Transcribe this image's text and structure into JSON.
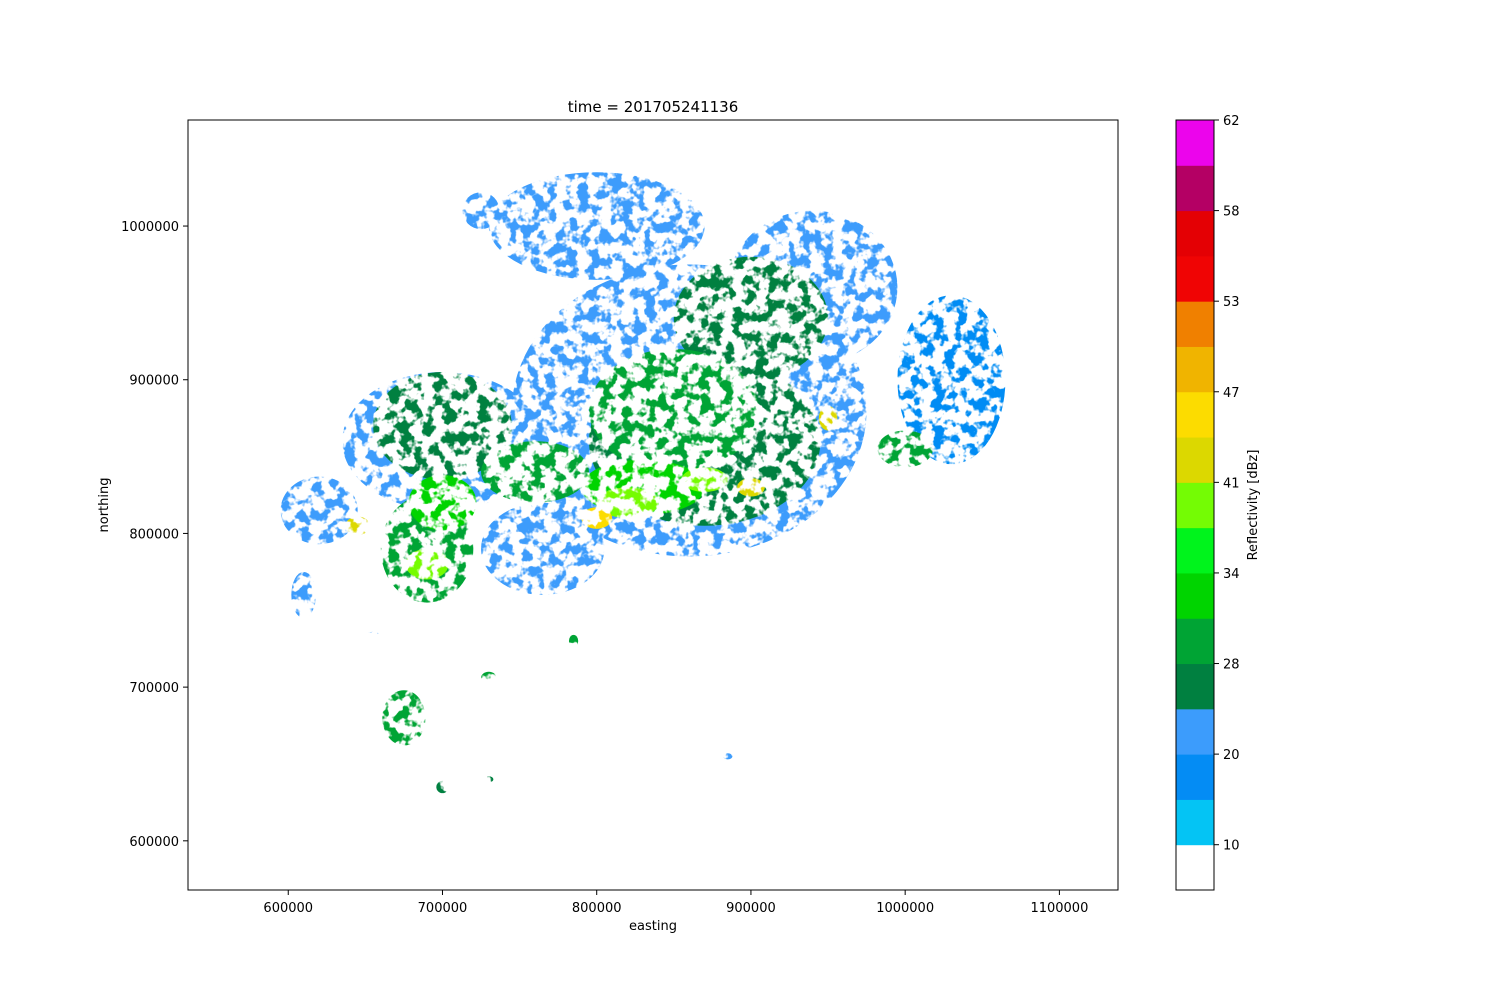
{
  "chart_data": {
    "type": "heatmap",
    "title": "time = 201705241136",
    "xlabel": "easting",
    "ylabel": "northing",
    "xlim": [
      535000,
      1138000
    ],
    "ylim": [
      568000,
      1069000
    ],
    "x_ticks": [
      600000,
      700000,
      800000,
      900000,
      1000000,
      1100000
    ],
    "y_ticks": [
      600000,
      700000,
      800000,
      900000,
      1000000
    ],
    "colorbar": {
      "label": "Reflectivity [dBz]",
      "tick_labels": [
        "10",
        "20",
        "28",
        "34",
        "41",
        "47",
        "53",
        "58",
        "62"
      ],
      "levels": [
        {
          "color": "#ffffff"
        },
        {
          "color": "#04c4f4"
        },
        {
          "color": "#048cf4"
        },
        {
          "color": "#3c9cfc"
        },
        {
          "color": "#008040"
        },
        {
          "color": "#00a434"
        },
        {
          "color": "#00d400"
        },
        {
          "color": "#00f41c"
        },
        {
          "color": "#74fc04"
        },
        {
          "color": "#dcd800"
        },
        {
          "color": "#fcdc00"
        },
        {
          "color": "#f0b400"
        },
        {
          "color": "#f08000"
        },
        {
          "color": "#f00404"
        },
        {
          "color": "#e40004"
        },
        {
          "color": "#b40064"
        },
        {
          "color": "#ec04ec"
        }
      ]
    },
    "echo_regions": [
      {
        "e": 860000,
        "n": 880000,
        "re": 115000,
        "rn": 95000,
        "level": 3
      },
      {
        "e": 700000,
        "n": 860000,
        "re": 65000,
        "rn": 45000,
        "level": 3
      },
      {
        "e": 940000,
        "n": 960000,
        "re": 55000,
        "rn": 50000,
        "level": 3
      },
      {
        "e": 800000,
        "n": 1000000,
        "re": 70000,
        "rn": 35000,
        "level": 3
      },
      {
        "e": 1030000,
        "n": 900000,
        "re": 35000,
        "rn": 55000,
        "level": 2
      },
      {
        "e": 620000,
        "n": 815000,
        "re": 25000,
        "rn": 22000,
        "level": 3
      },
      {
        "e": 765000,
        "n": 790000,
        "re": 40000,
        "rn": 30000,
        "level": 3
      },
      {
        "e": 870000,
        "n": 860000,
        "re": 75000,
        "rn": 55000,
        "level": 4
      },
      {
        "e": 900000,
        "n": 940000,
        "re": 50000,
        "rn": 40000,
        "level": 4
      },
      {
        "e": 700000,
        "n": 870000,
        "re": 45000,
        "rn": 35000,
        "level": 4
      },
      {
        "e": 850000,
        "n": 880000,
        "re": 55000,
        "rn": 40000,
        "level": 5
      },
      {
        "e": 760000,
        "n": 840000,
        "re": 35000,
        "rn": 20000,
        "level": 5
      },
      {
        "e": 690000,
        "n": 790000,
        "re": 30000,
        "rn": 35000,
        "level": 5
      },
      {
        "e": 830000,
        "n": 830000,
        "re": 40000,
        "rn": 18000,
        "level": 6
      },
      {
        "e": 700000,
        "n": 820000,
        "re": 22000,
        "rn": 18000,
        "level": 6
      },
      {
        "e": 820000,
        "n": 820000,
        "re": 20000,
        "rn": 10000,
        "level": 8
      },
      {
        "e": 870000,
        "n": 835000,
        "re": 15000,
        "rn": 8000,
        "level": 8
      },
      {
        "e": 690000,
        "n": 780000,
        "re": 14000,
        "rn": 10000,
        "level": 8
      },
      {
        "e": 800000,
        "n": 810000,
        "re": 10000,
        "rn": 7000,
        "level": 10
      },
      {
        "e": 900000,
        "n": 830000,
        "re": 9000,
        "rn": 6000,
        "level": 9
      },
      {
        "e": 950000,
        "n": 875000,
        "re": 6000,
        "rn": 8000,
        "level": 9
      },
      {
        "e": 645000,
        "n": 805000,
        "re": 8000,
        "rn": 6000,
        "level": 9
      },
      {
        "e": 675000,
        "n": 680000,
        "re": 14000,
        "rn": 18000,
        "level": 5
      },
      {
        "e": 700000,
        "n": 635000,
        "re": 4000,
        "rn": 4000,
        "level": 4
      },
      {
        "e": 610000,
        "n": 760000,
        "re": 8000,
        "rn": 15000,
        "level": 3
      },
      {
        "e": 585000,
        "n": 740000,
        "re": 0,
        "rn": 0,
        "level": 0
      },
      {
        "e": 730000,
        "n": 706000,
        "re": 5000,
        "rn": 4000,
        "level": 5
      },
      {
        "e": 730000,
        "n": 640000,
        "re": 3000,
        "rn": 2000,
        "level": 4
      },
      {
        "e": 655000,
        "n": 733000,
        "re": 5000,
        "rn": 3000,
        "level": 3
      },
      {
        "e": 725000,
        "n": 1010000,
        "re": 12000,
        "rn": 12000,
        "level": 3
      },
      {
        "e": 1000000,
        "n": 855000,
        "re": 18000,
        "rn": 12000,
        "level": 5
      },
      {
        "e": 785000,
        "n": 730000,
        "re": 3000,
        "rn": 4000,
        "level": 5
      },
      {
        "e": 885000,
        "n": 655000,
        "re": 3000,
        "rn": 2000,
        "level": 3
      }
    ]
  }
}
